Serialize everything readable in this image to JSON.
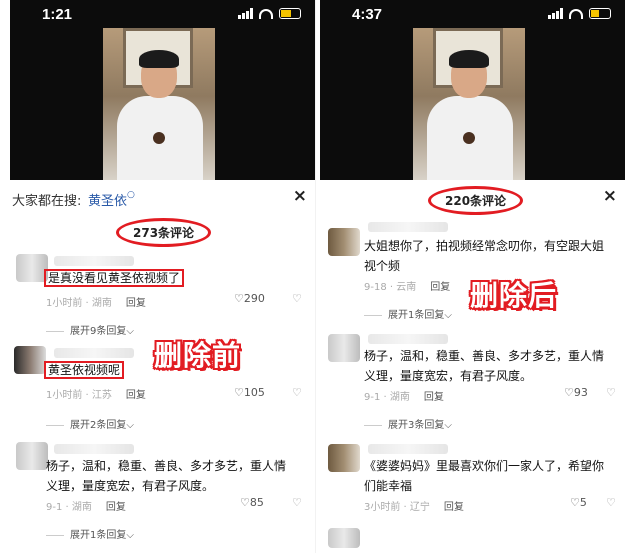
{
  "left": {
    "time": "1:21",
    "search_label": "大家都在搜:",
    "search_term": "黄圣依",
    "search_icon": "magnifier-icon",
    "close": "×",
    "count": "273条评论",
    "annotation": "删除前",
    "comments": [
      {
        "text": "是真没看见黄圣依视频了",
        "meta": "1小时前 · 湖南",
        "reply": "回复",
        "likes": "290",
        "expand": "展开9条回复"
      },
      {
        "text": "黄圣依视频呢",
        "meta": "1小时前 · 江苏",
        "reply": "回复",
        "likes": "105",
        "expand": "展开2条回复"
      },
      {
        "text_l1": "杨子，温和，稳重、善良、多才多艺，重人情",
        "text_l2": "义理，量度宽宏，有君子风度。",
        "meta": "9-1 · 湖南",
        "reply": "回复",
        "likes": "85",
        "expand": "展开1条回复"
      }
    ]
  },
  "right": {
    "time": "4:37",
    "close": "×",
    "count": "220条评论",
    "annotation": "删除后",
    "comments": [
      {
        "text_l1": "大姐想你了，拍视频经常念叨你，有空跟大姐",
        "text_l2": "视个频",
        "meta": "9-18 · 云南",
        "reply": "回复",
        "expand": "展开1条回复"
      },
      {
        "text_l1": "杨子，温和，稳重、善良、多才多艺，重人情",
        "text_l2": "义理，量度宽宏，有君子风度。",
        "meta": "9-1 · 湖南",
        "reply": "回复",
        "likes": "93",
        "expand": "展开3条回复"
      },
      {
        "text_l1": "《婆婆妈妈》里最喜欢你们一家人了，希望你",
        "text_l2": "们能幸福",
        "meta": "3小时前 · 辽宁",
        "reply": "回复",
        "likes": "5"
      }
    ]
  },
  "icons": {
    "heart": "heart-icon",
    "dislike": "dislike-icon",
    "chevron": "chevron-down-icon"
  },
  "colors": {
    "annotation_red": "#e21c22",
    "link_blue": "#2a5aa8"
  }
}
